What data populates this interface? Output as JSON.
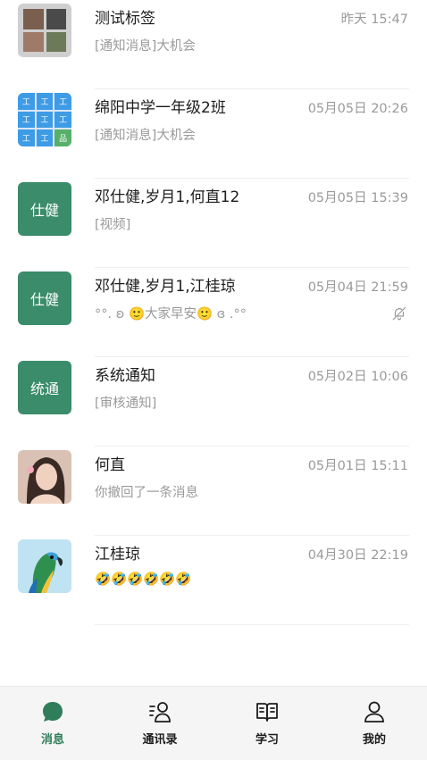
{
  "conversations": [
    {
      "name": "测试标签",
      "time": "昨天 15:47",
      "preview": "[通知消息]大机会",
      "avatar_type": "group-photo"
    },
    {
      "name": "绵阳中学一年级2班",
      "time": "05月05日 20:26",
      "preview": "[通知消息]大机会",
      "avatar_type": "group-grid"
    },
    {
      "name": "邓仕健,岁月1,何直12",
      "time": "05月05日 15:39",
      "preview": "[视频]",
      "avatar_text": "仕健"
    },
    {
      "name": "邓仕健,岁月1,江桂琼",
      "time": "05月04日 21:59",
      "preview": "°°. ʚ 🙂大家早安🙂 ɞ .°°",
      "avatar_text": "仕健",
      "muted": true
    },
    {
      "name": "系统通知",
      "time": "05月02日 10:06",
      "preview": "[审核通知]",
      "avatar_text": "统通"
    },
    {
      "name": "何直",
      "time": "05月01日 15:11",
      "preview": "你撤回了一条消息",
      "avatar_type": "photo-person"
    },
    {
      "name": "江桂琼",
      "time": "04月30日 22:19",
      "preview": "🤣🤣🤣🤣🤣🤣",
      "avatar_type": "photo-parrot"
    }
  ],
  "tabs": [
    {
      "label": "消息",
      "icon": "chat-bubble-icon",
      "active": true
    },
    {
      "label": "通讯录",
      "icon": "contacts-icon",
      "active": false
    },
    {
      "label": "学习",
      "icon": "book-icon",
      "active": false
    },
    {
      "label": "我的",
      "icon": "profile-icon",
      "active": false
    }
  ],
  "colors": {
    "accent": "#2f7d5a",
    "avatar_green": "#3a8c6b",
    "muted_text": "#9a9a9a"
  }
}
